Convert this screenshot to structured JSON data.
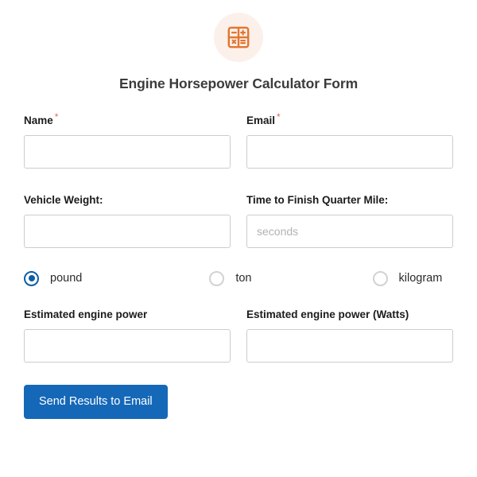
{
  "header": {
    "logo_icon": "calculator-icon",
    "logo_bg_color": "#fbf0ea",
    "logo_icon_color": "#e2762f",
    "title": "Engine Horsepower Calculator Form"
  },
  "colors": {
    "accent_blue": "#1568b8",
    "radio_selected": "#0d5ea8",
    "required_asterisk": "#e8655b",
    "input_border": "#cccccc",
    "placeholder": "#b2b2b2"
  },
  "fields": {
    "name": {
      "label": "Name",
      "required_mark": "*",
      "value": "",
      "placeholder": ""
    },
    "email": {
      "label": "Email",
      "required_mark": "*",
      "value": "",
      "placeholder": ""
    },
    "vehicle_weight": {
      "label": "Vehicle Weight:",
      "value": "",
      "placeholder": ""
    },
    "quarter_mile_time": {
      "label": "Time to Finish Quarter Mile:",
      "value": "",
      "placeholder": "seconds"
    },
    "estimated_power": {
      "label": "Estimated engine power",
      "value": "",
      "placeholder": ""
    },
    "estimated_power_watts": {
      "label": "Estimated engine power (Watts)",
      "value": "",
      "placeholder": ""
    }
  },
  "weight_unit": {
    "selected": "pound",
    "options": [
      {
        "label": "pound",
        "checked": true
      },
      {
        "label": "ton",
        "checked": false
      },
      {
        "label": "kilogram",
        "checked": false
      }
    ]
  },
  "submit": {
    "label": "Send Results to Email"
  }
}
